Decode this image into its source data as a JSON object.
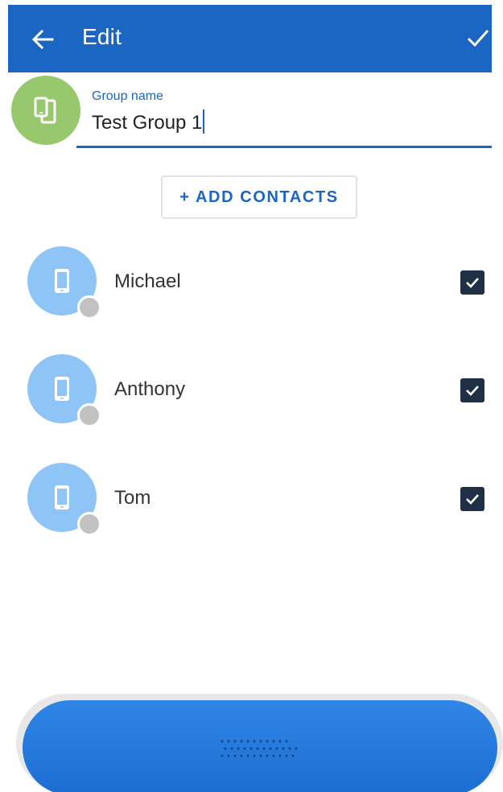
{
  "app_bar": {
    "title": "Edit",
    "back_icon": "arrow-left-icon",
    "confirm_icon": "check-icon",
    "color": "#1a66c2"
  },
  "group": {
    "avatar_icon": "devices-icon",
    "avatar_color": "#98c86e",
    "label": "Group name",
    "value": "Test Group 1"
  },
  "add_contacts": {
    "label": "+ ADD CONTACTS"
  },
  "contacts": [
    {
      "name": "Michael",
      "checked": true,
      "icon": "phone-icon",
      "presence": "offline"
    },
    {
      "name": "Anthony",
      "checked": true,
      "icon": "phone-icon",
      "presence": "offline"
    },
    {
      "name": "Tom",
      "checked": true,
      "icon": "phone-icon",
      "presence": "offline"
    }
  ],
  "bottom_bar": {
    "icon": "grip-dots-icon",
    "color": "#2a7ddf"
  }
}
